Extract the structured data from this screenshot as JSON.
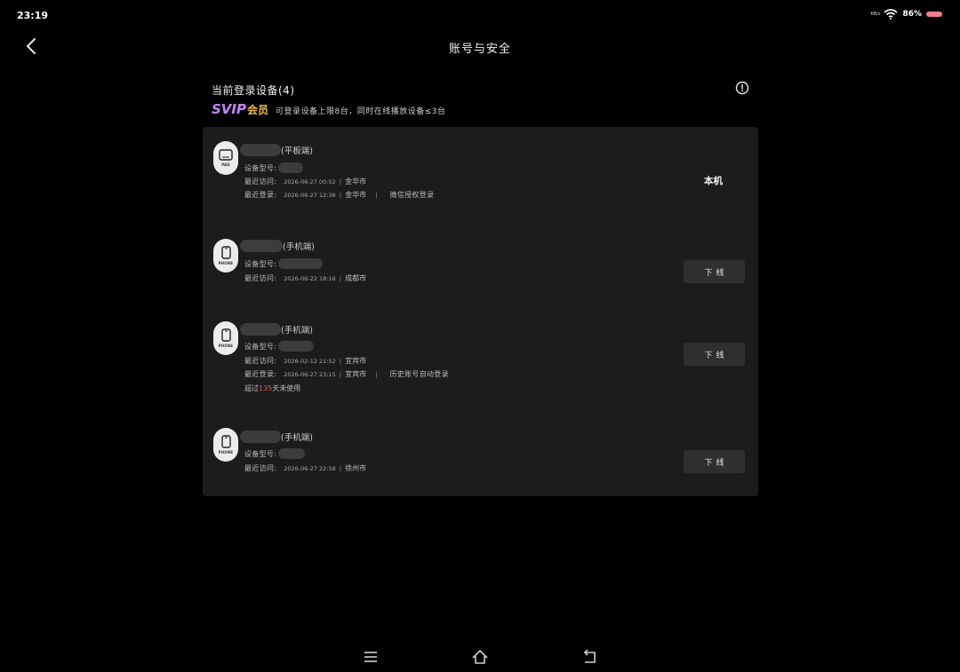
{
  "status_bar": {
    "time": "23:19",
    "network_label": "KB/s",
    "battery_percent": "86%",
    "battery_color": "#f07f8a"
  },
  "header": {
    "title": "账号与安全",
    "back_icon": "chevron-left-icon"
  },
  "section": {
    "title": "当前登录设备(4)",
    "info_icon": "info-circle-icon",
    "vip_badge": "SVIP",
    "vip_member": "会员",
    "vip_description": "可登录设备上限8台，同时在线播放设备≤3台"
  },
  "devices": [
    {
      "type_label": "PAD",
      "name_suffix": "(平板端)",
      "model_label": "设备型号:",
      "visit_label": "最近访问:",
      "visit_time": "2026-06-27 00:52",
      "visit_city": "金华市",
      "login_label": "最近登录:",
      "login_time": "2026-06-27 12:38",
      "login_city": "金华市",
      "login_method": "微信授权登录",
      "status": "本机"
    },
    {
      "type_label": "PHONE",
      "name_suffix": "(手机端)",
      "model_label": "设备型号:",
      "visit_label": "最近访问:",
      "visit_time": "2026-06-22 18:16",
      "visit_city": "成都市",
      "action": "下线"
    },
    {
      "type_label": "PHONE",
      "name_suffix": "(手机端)",
      "model_label": "设备型号:",
      "visit_label": "最近访问:",
      "visit_time": "2026-02-12 21:52",
      "visit_city": "宜宾市",
      "login_label": "最近登录:",
      "login_time": "2026-06-27 23:15",
      "login_city": "宜宾市",
      "login_method": "历史账号自动登录",
      "unused_prefix": "超过",
      "unused_days": "135",
      "unused_suffix": "天未使用",
      "action": "下线"
    },
    {
      "type_label": "PHONE",
      "name_suffix": "(手机端)",
      "model_label": "设备型号:",
      "visit_label": "最近访问:",
      "visit_time": "2026-06-27 22:58",
      "visit_city": "徐州市",
      "action": "下线"
    }
  ],
  "nav_bar": {
    "menu_icon": "menu-icon",
    "home_icon": "home-icon",
    "back_icon": "back-arrow-icon"
  }
}
